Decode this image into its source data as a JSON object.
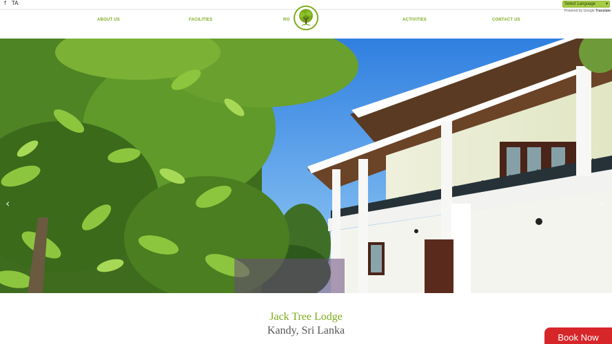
{
  "social": {
    "facebook": "f",
    "tripadvisor": "TA"
  },
  "translate": {
    "select_label": "Select Language",
    "powered_by": "Powered by",
    "google": "Google",
    "translate": "Translate"
  },
  "nav": {
    "about": "ABOUT US",
    "facilities": "FACILITIES",
    "rooms": "RO",
    "activities": "ACTIVITIES",
    "contact": "CONTACT US"
  },
  "hero": {
    "prev": "‹",
    "next": "›"
  },
  "title": "Jack Tree Lodge",
  "subtitle": "Kandy, Sri Lanka",
  "book_now": "Book Now"
}
